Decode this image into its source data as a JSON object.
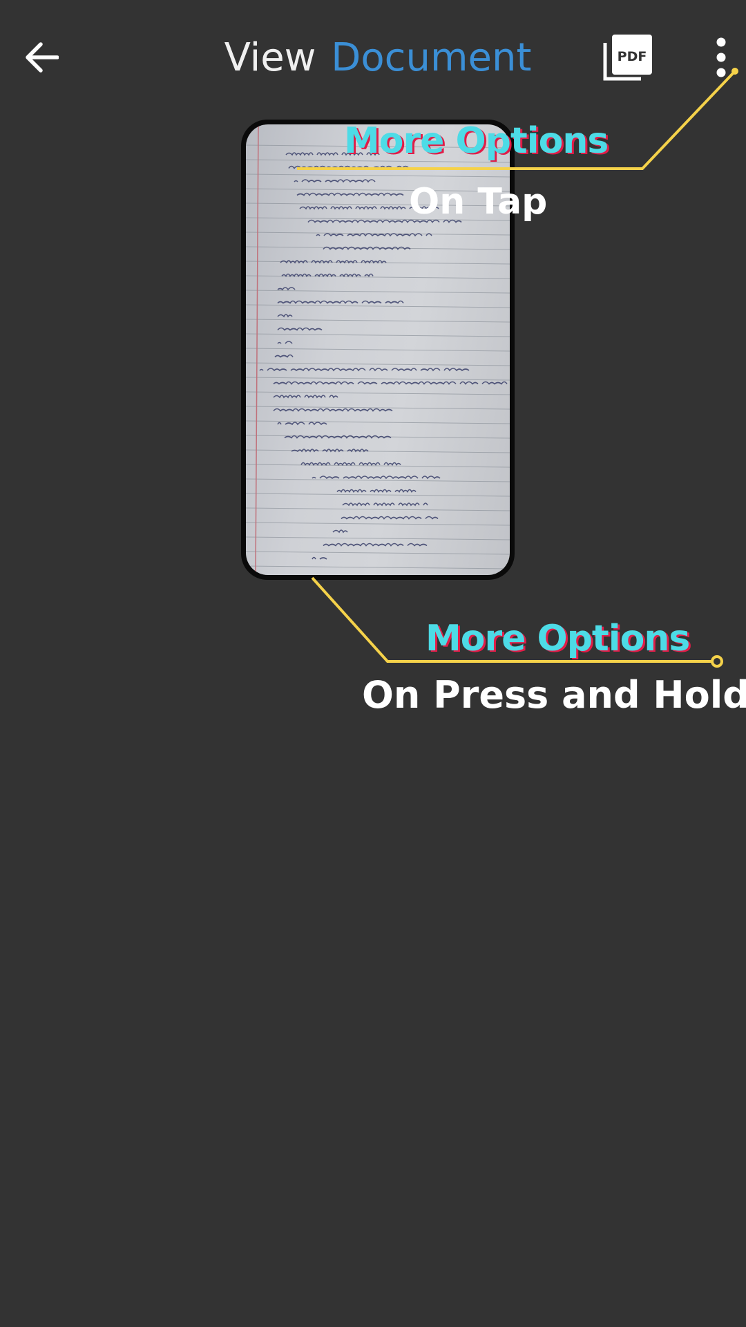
{
  "app_bar": {
    "title_part1": "View",
    "title_part2": "Document",
    "title_part2_color": "#3b8fd6",
    "back_icon": "arrow-left-icon",
    "pdf_icon": "pdf-icon",
    "pdf_icon_label": "PDF",
    "more_icon": "more-vertical-icon"
  },
  "document": {
    "description": "scanned handwritten notebook page"
  },
  "annotations": {
    "accent_color": "#f5d24a",
    "title_color": "#4ddbe6",
    "tap_hint": {
      "title": "More Options",
      "subtitle": "On Tap"
    },
    "hold_hint": {
      "title": "More Options",
      "subtitle": "On Press and Hold"
    }
  }
}
